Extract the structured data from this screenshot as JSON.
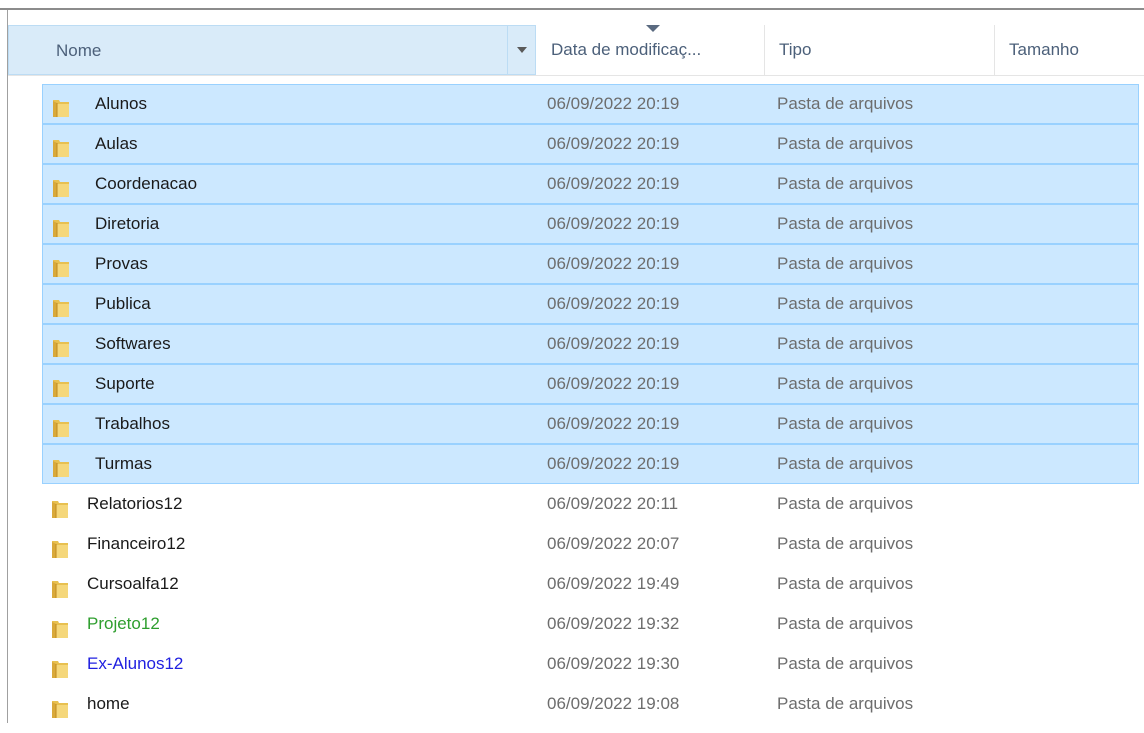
{
  "header": {
    "name": "Nome",
    "date": "Data de modificaç...",
    "type": "Tipo",
    "size": "Tamanho"
  },
  "colors": {
    "selection_bg": "#cce8ff",
    "selection_border": "#99d1ff",
    "compressed_green": "#2e9e2e",
    "encrypted_blue": "#1f1fe0"
  },
  "rows": [
    {
      "name": "Alunos",
      "date": "06/09/2022 20:19",
      "type": "Pasta de arquivos",
      "selected": true
    },
    {
      "name": "Aulas",
      "date": "06/09/2022 20:19",
      "type": "Pasta de arquivos",
      "selected": true
    },
    {
      "name": "Coordenacao",
      "date": "06/09/2022 20:19",
      "type": "Pasta de arquivos",
      "selected": true
    },
    {
      "name": "Diretoria",
      "date": "06/09/2022 20:19",
      "type": "Pasta de arquivos",
      "selected": true
    },
    {
      "name": "Provas",
      "date": "06/09/2022 20:19",
      "type": "Pasta de arquivos",
      "selected": true
    },
    {
      "name": "Publica",
      "date": "06/09/2022 20:19",
      "type": "Pasta de arquivos",
      "selected": true
    },
    {
      "name": "Softwares",
      "date": "06/09/2022 20:19",
      "type": "Pasta de arquivos",
      "selected": true
    },
    {
      "name": "Suporte",
      "date": "06/09/2022 20:19",
      "type": "Pasta de arquivos",
      "selected": true
    },
    {
      "name": "Trabalhos",
      "date": "06/09/2022 20:19",
      "type": "Pasta de arquivos",
      "selected": true
    },
    {
      "name": "Turmas",
      "date": "06/09/2022 20:19",
      "type": "Pasta de arquivos",
      "selected": true
    },
    {
      "name": "Relatorios12",
      "date": "06/09/2022 20:11",
      "type": "Pasta de arquivos",
      "selected": false
    },
    {
      "name": "Financeiro12",
      "date": "06/09/2022 20:07",
      "type": "Pasta de arquivos",
      "selected": false
    },
    {
      "name": "Cursoalfa12",
      "date": "06/09/2022 19:49",
      "type": "Pasta de arquivos",
      "selected": false
    },
    {
      "name": "Projeto12",
      "date": "06/09/2022 19:32",
      "type": "Pasta de arquivos",
      "selected": false,
      "color": "green"
    },
    {
      "name": "Ex-Alunos12",
      "date": "06/09/2022 19:30",
      "type": "Pasta de arquivos",
      "selected": false,
      "color": "blue"
    },
    {
      "name": "home",
      "date": "06/09/2022 19:08",
      "type": "Pasta de arquivos",
      "selected": false
    }
  ]
}
